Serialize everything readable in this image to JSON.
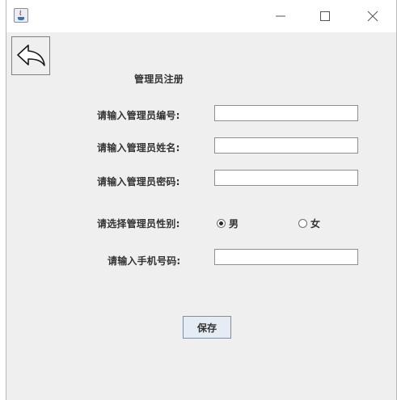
{
  "window": {
    "title": "",
    "controls": {
      "minimize": "—",
      "maximize": "☐",
      "close": "✕"
    }
  },
  "form": {
    "heading": "管理员注册",
    "id_label": "请输入管理员编号:",
    "id_value": "",
    "name_label": "请输入管理员姓名:",
    "name_value": "",
    "password_label": "请输入管理员密码:",
    "password_value": "",
    "gender_label": "请选择管理员性别:",
    "gender_options": [
      "男",
      "女"
    ],
    "gender_selected": "男",
    "phone_label": "请输入手机号码:",
    "phone_value": "",
    "save_label": "保存"
  },
  "icons": {
    "app": "java-icon",
    "back": "back-arrow-icon"
  }
}
